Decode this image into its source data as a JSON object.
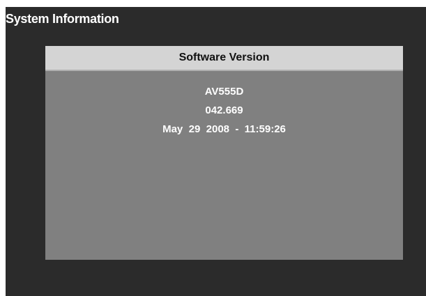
{
  "panel": {
    "title": "System Information"
  },
  "software_version": {
    "header": "Software Version",
    "model": "AV555D",
    "version": "042.669",
    "build_date": "May  29  2008  -  11:59:26"
  }
}
